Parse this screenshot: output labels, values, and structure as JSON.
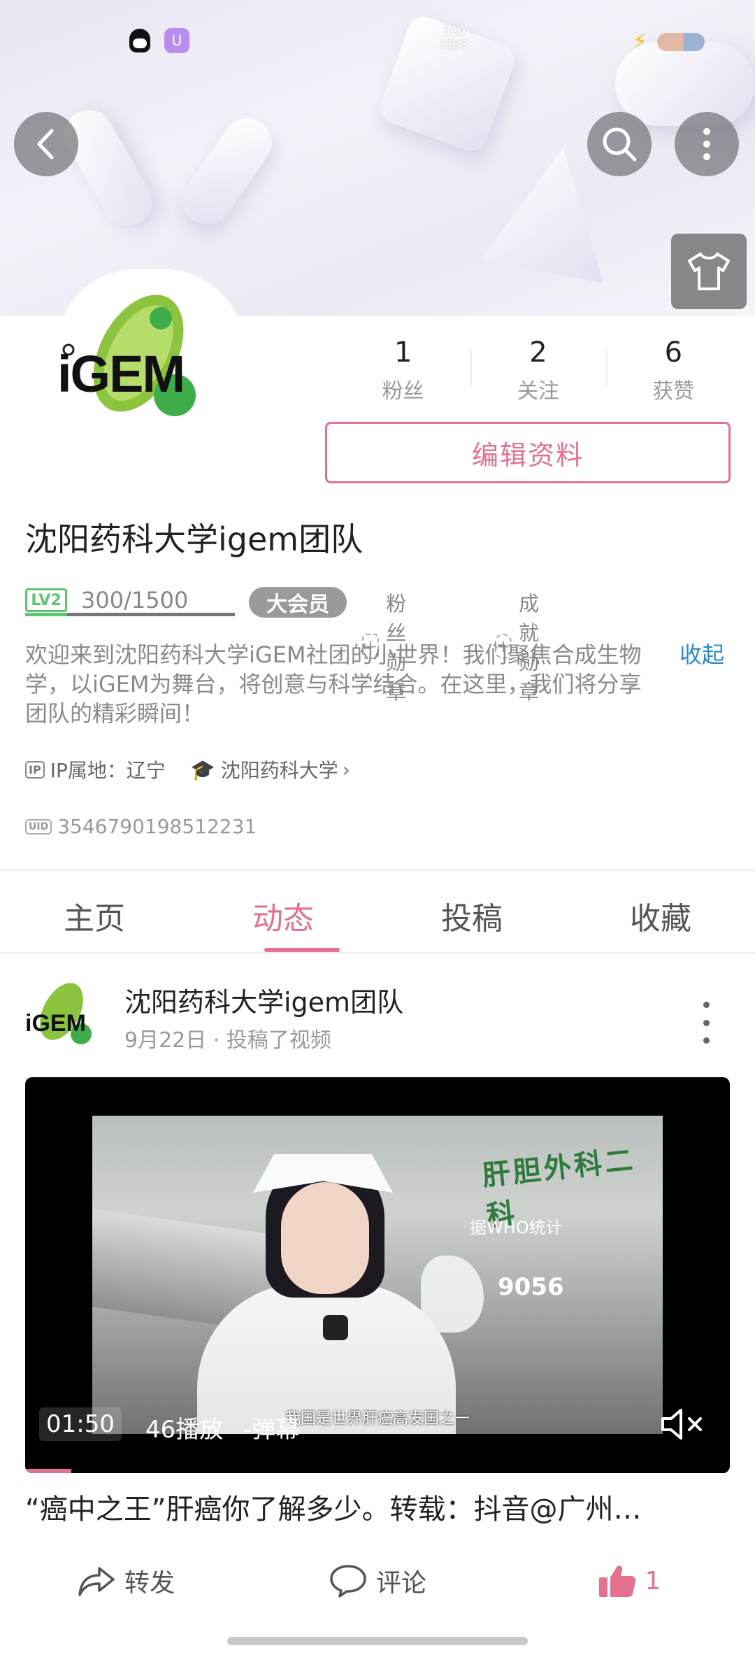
{
  "status_bar": {
    "net_speed_value": "320",
    "net_speed_unit": "KB/S",
    "app_badge": "U"
  },
  "profile": {
    "username": "沈阳药科大学igem团队",
    "logo_text": "iGEM",
    "stats": [
      {
        "value": "1",
        "label": "粉丝"
      },
      {
        "value": "2",
        "label": "关注"
      },
      {
        "value": "6",
        "label": "获赞"
      }
    ],
    "edit_label": "编辑资料",
    "level": {
      "badge": "LV2",
      "progress_text": "300/1500",
      "progress": 0.2
    },
    "vip_label": "大会员",
    "fan_medal_label": "粉丝勋章",
    "achievement_medal_label": "成就勋章",
    "bio": "欢迎来到沈阳药科大学iGEM社团的小世界！我们聚焦合成生物学，以iGEM为舞台，将创意与科学结合。在这里，我们将分享团队的精彩瞬间！",
    "collapse_label": "收起",
    "ip_tag": "IP",
    "ip_text": "IP属地：辽宁",
    "school": "沈阳药科大学",
    "uid_tag": "UID",
    "uid": "3546790198512231"
  },
  "tabs": [
    {
      "label": "主页",
      "active": false
    },
    {
      "label": "动态",
      "active": true
    },
    {
      "label": "投稿",
      "active": false
    },
    {
      "label": "收藏",
      "active": false
    }
  ],
  "post": {
    "author": "沈阳药科大学igem团队",
    "avatar_text": "iGEM",
    "meta": "9月22日 · 投稿了视频",
    "video": {
      "duration": "01:50",
      "views": "46播放",
      "danmaku": "-弹幕",
      "progress": 0.065,
      "frame_texts": {
        "wall_sign": "肝胆外科二科",
        "stat": "据WHO统计",
        "number": "9056",
        "subtitle": "我国是世界肝癌高发国之一"
      }
    },
    "title": "“癌中之王”肝癌你了解多少。转载：抖音@广州…",
    "actions": [
      {
        "label": "转发",
        "icon": "share-icon"
      },
      {
        "label": "评论",
        "icon": "comment-icon"
      },
      {
        "label": "1",
        "icon": "thumbs-up-icon"
      }
    ]
  },
  "colors": {
    "accent": "#e4718f",
    "link": "#2e8bc7",
    "level_green": "#5fc472"
  }
}
